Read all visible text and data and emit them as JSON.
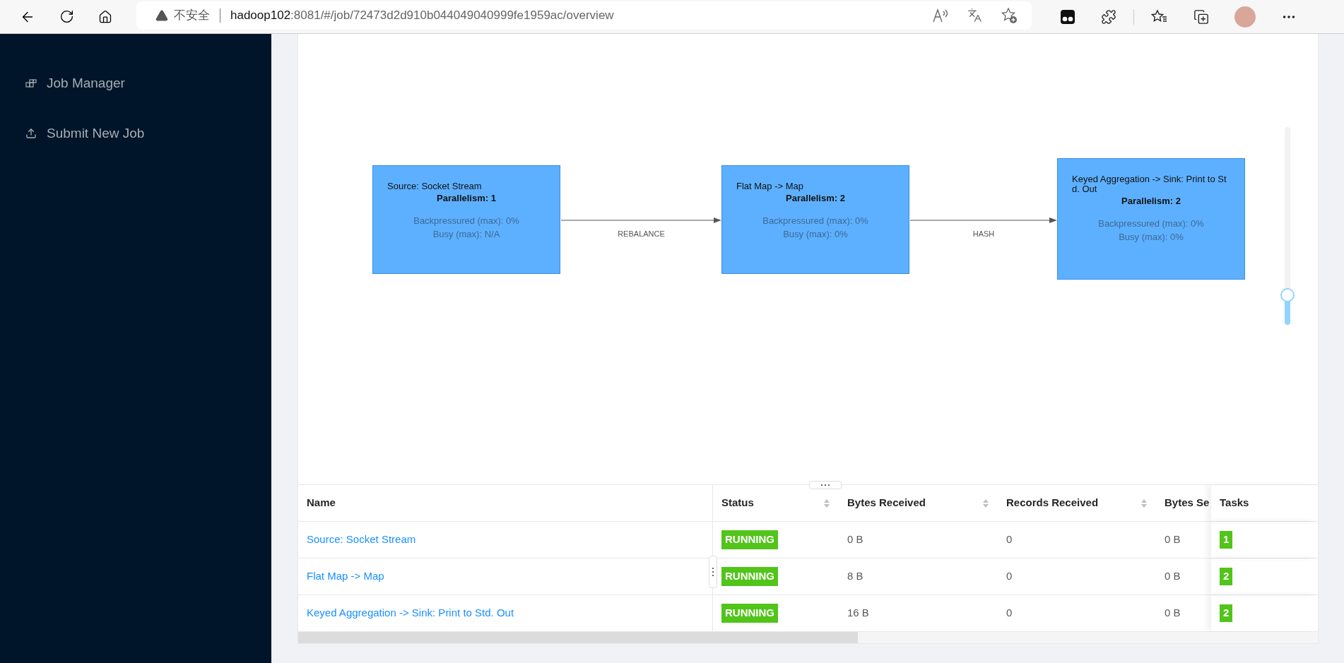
{
  "browser": {
    "security_label": "不安全",
    "url_host": "hadoop102",
    "url_rest": ":8081/#/job/72473d2d910b044049040999fe1959ac/overview"
  },
  "sidebar": {
    "items": [
      {
        "label": "Job Manager",
        "kind": "job-manager"
      },
      {
        "label": "Submit New Job",
        "kind": "submit"
      }
    ]
  },
  "graph": {
    "nodes": [
      {
        "title": "Source: Socket Stream",
        "parallelism": "Parallelism: 1",
        "backpressured": "Backpressured (max): 0%",
        "busy": "Busy (max): N/A"
      },
      {
        "title": "Flat Map -> Map",
        "parallelism": "Parallelism: 2",
        "backpressured": "Backpressured (max): 0%",
        "busy": "Busy (max): 0%"
      },
      {
        "title": "Keyed Aggregation -> Sink: Print to Std. Out",
        "parallelism": "Parallelism: 2",
        "backpressured": "Backpressured (max): 0%",
        "busy": "Busy (max): 0%"
      }
    ],
    "edges": [
      {
        "label": "REBALANCE"
      },
      {
        "label": "HASH"
      }
    ],
    "zoom": {
      "level": 0.15
    }
  },
  "table": {
    "columns": [
      {
        "label": "Name",
        "sortable": false
      },
      {
        "label": "Status",
        "sortable": true
      },
      {
        "label": "Bytes Received",
        "sortable": true
      },
      {
        "label": "Records Received",
        "sortable": true
      },
      {
        "label": "Bytes Se"
      },
      {
        "label": "Tasks",
        "sortable": false
      }
    ],
    "rows": [
      {
        "name": "Source: Socket Stream",
        "status": "RUNNING",
        "bytes_received": "0 B",
        "records_received": "0",
        "bytes_sent": "0 B",
        "tasks": "1"
      },
      {
        "name": "Flat Map -> Map",
        "status": "RUNNING",
        "bytes_received": "8 B",
        "records_received": "0",
        "bytes_sent": "0 B",
        "tasks": "2"
      },
      {
        "name": "Keyed Aggregation -> Sink: Print to Std. Out",
        "status": "RUNNING",
        "bytes_received": "16 B",
        "records_received": "0",
        "bytes_sent": "0 B",
        "tasks": "2"
      }
    ]
  }
}
